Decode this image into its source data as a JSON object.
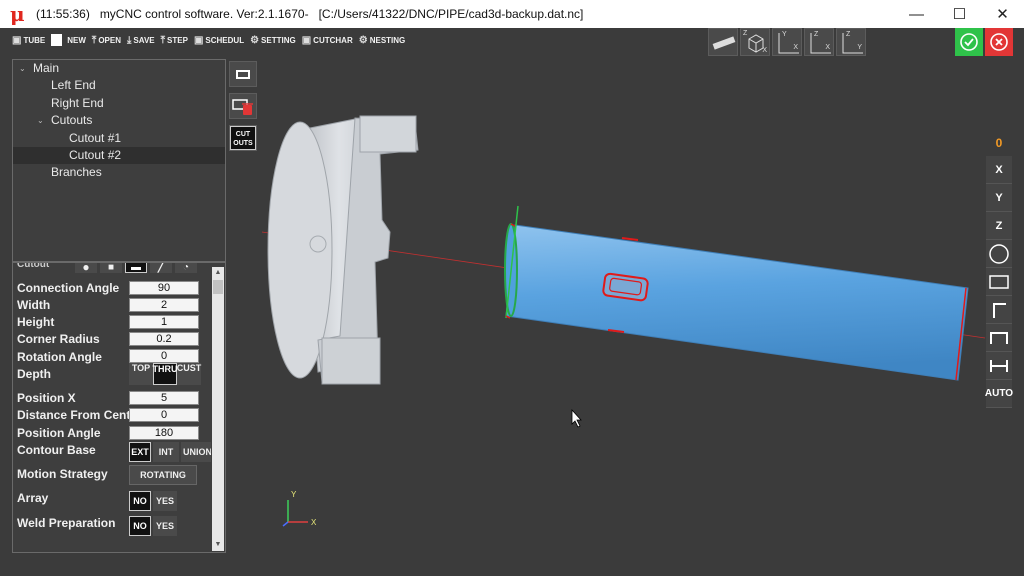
{
  "titlebar": {
    "logo": "μ",
    "time": "(11:55:36)",
    "app_name": "myCNC control software. Ver:2.1.1670-",
    "file_path": "[C:/Users/41322/DNC/PIPE/cad3d-backup.dat.nc]",
    "minimize": "—",
    "maximize": "☐",
    "close": "✕"
  },
  "toolbar": [
    {
      "label": "TUBE",
      "icon": "tube-icon"
    },
    {
      "label": "NEW",
      "icon": "new-icon"
    },
    {
      "label": "OPEN",
      "icon": "upload-icon"
    },
    {
      "label": "SAVE",
      "icon": "download-icon"
    },
    {
      "label": "STEP",
      "icon": "upload-icon"
    },
    {
      "label": "SCHEDUL",
      "icon": "schedule-icon"
    },
    {
      "label": "SETTING",
      "icon": "gear-icon"
    },
    {
      "label": "CUTCHAR",
      "icon": "cut-icon"
    },
    {
      "label": "NESTING",
      "icon": "nesting-icon"
    }
  ],
  "tree": {
    "items": [
      {
        "label": "Main",
        "level": 0
      },
      {
        "label": "Left End",
        "level": 1
      },
      {
        "label": "Right End",
        "level": 1
      },
      {
        "label": "Cutouts",
        "level": 1
      },
      {
        "label": "Cutout #1",
        "level": 2
      },
      {
        "label": "Cutout #2",
        "level": 2
      },
      {
        "label": "Branches",
        "level": 1
      }
    ],
    "selected": "Cutout #2"
  },
  "tools": {
    "cutouts_label_1": "CUT",
    "cutouts_label_2": "OUTS"
  },
  "props": {
    "header": "Cutout",
    "connection_angle": {
      "label": "Connection Angle",
      "value": "90"
    },
    "width": {
      "label": "Width",
      "value": "2"
    },
    "height": {
      "label": "Height",
      "value": "1"
    },
    "corner_radius": {
      "label": "Corner Radius",
      "value": "0.2"
    },
    "rotation_angle": {
      "label": "Rotation Angle",
      "value": "0"
    },
    "depth": {
      "label": "Depth",
      "options": [
        "TOP",
        "THRU",
        "CUST"
      ],
      "selected": "THRU"
    },
    "position_x": {
      "label": "Position X",
      "value": "5"
    },
    "distance_from_center": {
      "label": "Distance From Center",
      "value": "0"
    },
    "position_angle": {
      "label": "Position Angle",
      "value": "180"
    },
    "contour_base": {
      "label": "Contour Base",
      "options": [
        "EXT",
        "INT",
        "UNION"
      ],
      "selected": "EXT"
    },
    "motion_strategy": {
      "label": "Motion Strategy",
      "value": "ROTATING"
    },
    "array": {
      "label": "Array",
      "no": "NO",
      "yes": "YES",
      "selected": "NO"
    },
    "weld_preparation": {
      "label": "Weld Preparation",
      "no": "NO",
      "yes": "YES",
      "selected": "NO"
    }
  },
  "views": [
    {
      "name": "ruler-view",
      "axes": []
    },
    {
      "name": "iso-view",
      "axes": [
        "Z",
        "X"
      ]
    },
    {
      "name": "xy-view",
      "axes": [
        "Y",
        "X"
      ]
    },
    {
      "name": "zx-view",
      "axes": [
        "Z",
        "X"
      ]
    },
    {
      "name": "zy-view",
      "axes": [
        "Z",
        "Y"
      ]
    }
  ],
  "side": {
    "counter": "0",
    "buttons": [
      "X",
      "Y",
      "Z",
      "circle-shape",
      "rect-shape",
      "corner-shape",
      "channel-shape",
      "ibeam-shape",
      "AUTO"
    ]
  },
  "axis_triad": {
    "x": "X",
    "y": "Y"
  },
  "colors": {
    "pipe": "#5aa3e0",
    "chuck": "#cfd3d8",
    "cut_red": "#e01a1a",
    "ok_green": "#2fc24a",
    "cancel_red": "#e23636",
    "counter_orange": "#f39a25"
  }
}
